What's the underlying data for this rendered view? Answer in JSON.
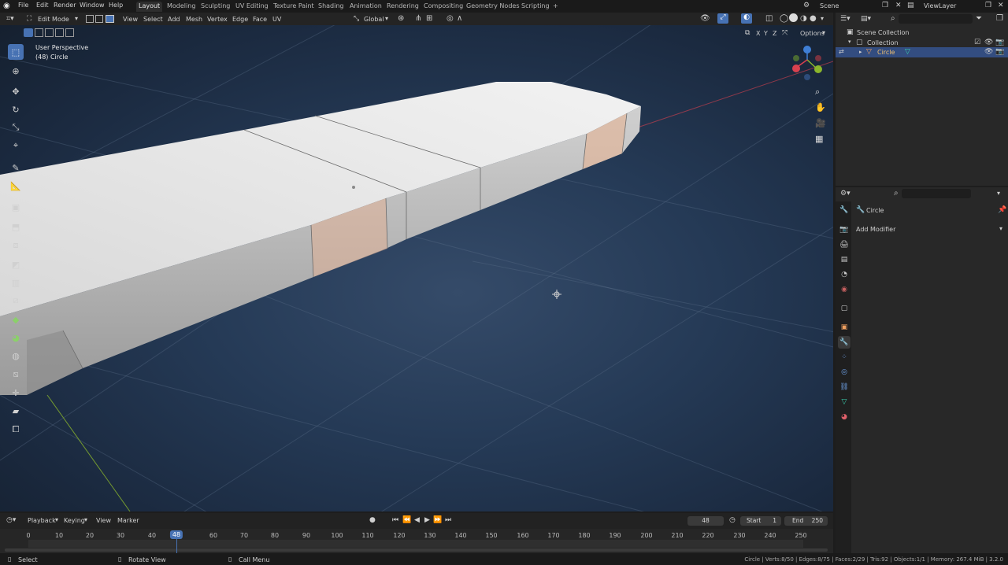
{
  "topbar": {
    "menus": [
      "File",
      "Edit",
      "Render",
      "Window",
      "Help"
    ],
    "workspaces": [
      "Layout",
      "Modeling",
      "Sculpting",
      "UV Editing",
      "Texture Paint",
      "Shading",
      "Animation",
      "Rendering",
      "Compositing",
      "Geometry Nodes",
      "Scripting"
    ],
    "active_workspace": "Layout",
    "add_tab": "+",
    "scene": "Scene",
    "view_layer": "ViewLayer"
  },
  "viewport_header": {
    "mode": "Edit Mode",
    "menus": [
      "View",
      "Select",
      "Add",
      "Mesh",
      "Vertex",
      "Edge",
      "Face",
      "UV"
    ],
    "orientation": "Global",
    "axes": [
      "X",
      "Y",
      "Z"
    ],
    "options": "Options"
  },
  "viewport": {
    "view_name": "User Perspective",
    "object_label": "(48) Circle"
  },
  "outliner": {
    "scene_collection": "Scene Collection",
    "collection": "Collection",
    "object": "Circle"
  },
  "properties": {
    "object_name": "Circle",
    "add_modifier": "Add Modifier"
  },
  "timeline": {
    "menus": [
      "Playback",
      "Keying",
      "View",
      "Marker"
    ],
    "current_frame": "48",
    "start_label": "Start",
    "start": "1",
    "end_label": "End",
    "end": "250",
    "ticks": [
      "0",
      "10",
      "20",
      "30",
      "40",
      "48",
      "60",
      "70",
      "80",
      "90",
      "100",
      "110",
      "120",
      "130",
      "140",
      "150",
      "160",
      "170",
      "180",
      "190",
      "200",
      "210",
      "220",
      "230",
      "240",
      "250"
    ]
  },
  "statusbar": {
    "select": "Select",
    "rotate": "Rotate View",
    "call_menu": "Call Menu",
    "stats": "Circle | Verts:8/50 | Edges:8/75 | Faces:2/29 | Tris:92 | Objects:1/1 | Memory: 267.4 MiB | 3.2.0"
  },
  "colors": {
    "accent": "#4772b3",
    "selection_orange": "#e8b08e",
    "axis_x": "#d9414f",
    "axis_y": "#8bb62c",
    "axis_z": "#3f7fd6"
  }
}
